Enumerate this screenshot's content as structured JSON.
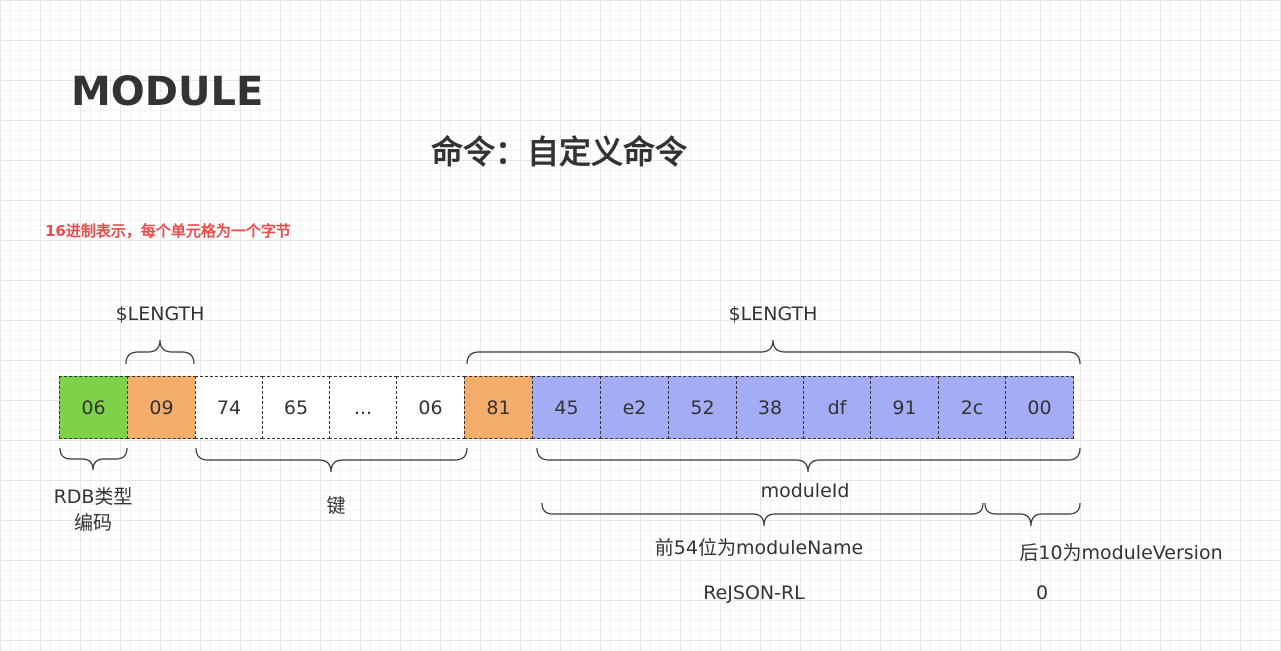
{
  "header": {
    "title": "MODULE",
    "subtitle": "命令：自定义命令",
    "note": "16进制表示，每个单元格为一个字节"
  },
  "colors": {
    "type_cell": "#7ed24a",
    "length_cell": "#f4ad6b",
    "plain_cell": "#ffffff",
    "module_id_cell": "#a3acf5",
    "note_text": "#e84c4c",
    "stroke": "#333333"
  },
  "cells": [
    {
      "value": "06",
      "kind": "type_cell"
    },
    {
      "value": "09",
      "kind": "length_cell"
    },
    {
      "value": "74",
      "kind": "plain_cell"
    },
    {
      "value": "65",
      "kind": "plain_cell"
    },
    {
      "value": "...",
      "kind": "plain_cell"
    },
    {
      "value": "06",
      "kind": "plain_cell"
    },
    {
      "value": "81",
      "kind": "length_cell"
    },
    {
      "value": "45",
      "kind": "module_id_cell"
    },
    {
      "value": "e2",
      "kind": "module_id_cell"
    },
    {
      "value": "52",
      "kind": "module_id_cell"
    },
    {
      "value": "38",
      "kind": "module_id_cell"
    },
    {
      "value": "df",
      "kind": "module_id_cell"
    },
    {
      "value": "91",
      "kind": "module_id_cell"
    },
    {
      "value": "2c",
      "kind": "module_id_cell"
    },
    {
      "value": "00",
      "kind": "module_id_cell"
    }
  ],
  "labels": {
    "length_key": "$LENGTH",
    "length_module": "$LENGTH",
    "rdb_type_line1": "RDB类型",
    "rdb_type_line2": "编码",
    "key": "键",
    "module_id": "moduleId",
    "module_name_bits": "前54位为moduleName",
    "module_version_bits": "后10为moduleVersion",
    "module_name_value": "ReJSON-RL",
    "module_version_value": "0"
  }
}
